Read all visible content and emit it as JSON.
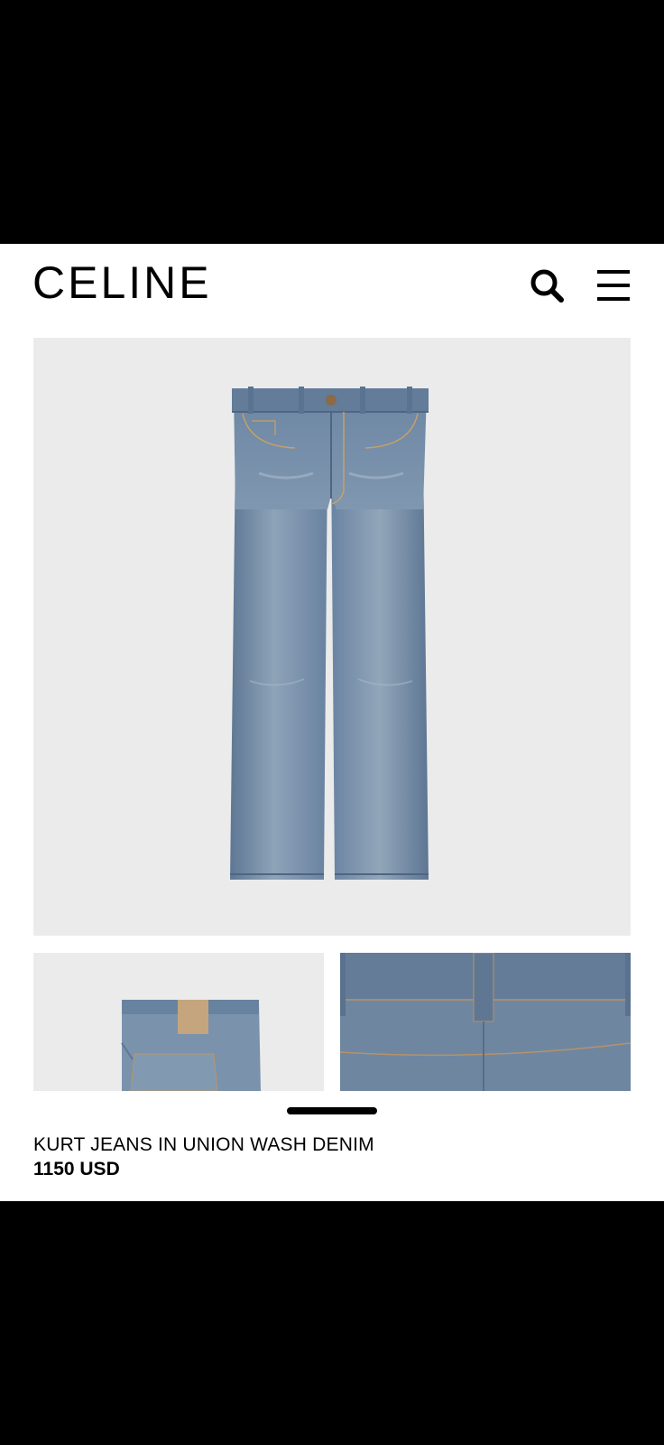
{
  "header": {
    "brand": "CELINE",
    "search_icon": "search-icon",
    "menu_icon": "hamburger-menu-icon"
  },
  "product": {
    "name": "KURT JEANS IN UNION WASH DENIM",
    "price": "1150 USD"
  },
  "colors": {
    "denim": "#7790ab",
    "image_background": "#ebebeb",
    "text": "#000000"
  }
}
